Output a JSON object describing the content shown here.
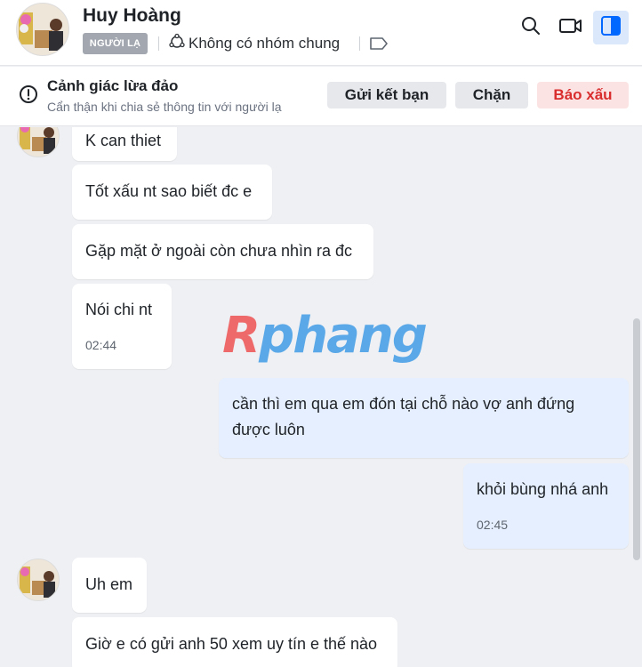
{
  "header": {
    "contact_name": "Huy Hoàng",
    "stranger_badge": "NGƯỜI LẠ",
    "common_group_text": "Không có nhóm chung",
    "icons": [
      "search-icon",
      "video-call-icon",
      "sidebar-toggle-icon"
    ]
  },
  "warning": {
    "title": "Cảnh giác lừa đảo",
    "subtitle": "Cẩn thận khi chia sẻ thông tin với người lạ",
    "add_friend_label": "Gửi kết bạn",
    "block_label": "Chặn",
    "report_label": "Báo xấu"
  },
  "messages": [
    {
      "from": "them",
      "text": "K can thiet"
    },
    {
      "from": "them",
      "text": "Tốt xấu nt sao biết đc e"
    },
    {
      "from": "them",
      "text": "Gặp mặt ở ngoài còn chưa nhìn ra đc"
    },
    {
      "from": "them",
      "text": "Nói chi nt",
      "time": "02:44"
    },
    {
      "from": "me",
      "text": "cần thì em qua em đón tại chỗ nào vợ anh đứng được luôn"
    },
    {
      "from": "me",
      "text": "khỏi bùng nhá anh",
      "time": "02:45"
    },
    {
      "from": "them",
      "text": "Uh em"
    },
    {
      "from": "them",
      "text": "Giờ e có gửi anh 50 xem uy tín e thế nào"
    }
  ],
  "watermark": {
    "part1": "R",
    "part2": "phang"
  },
  "colors": {
    "accent": "#0068ff",
    "my_bubble": "#e5efff",
    "report_red": "#d92d2d"
  }
}
